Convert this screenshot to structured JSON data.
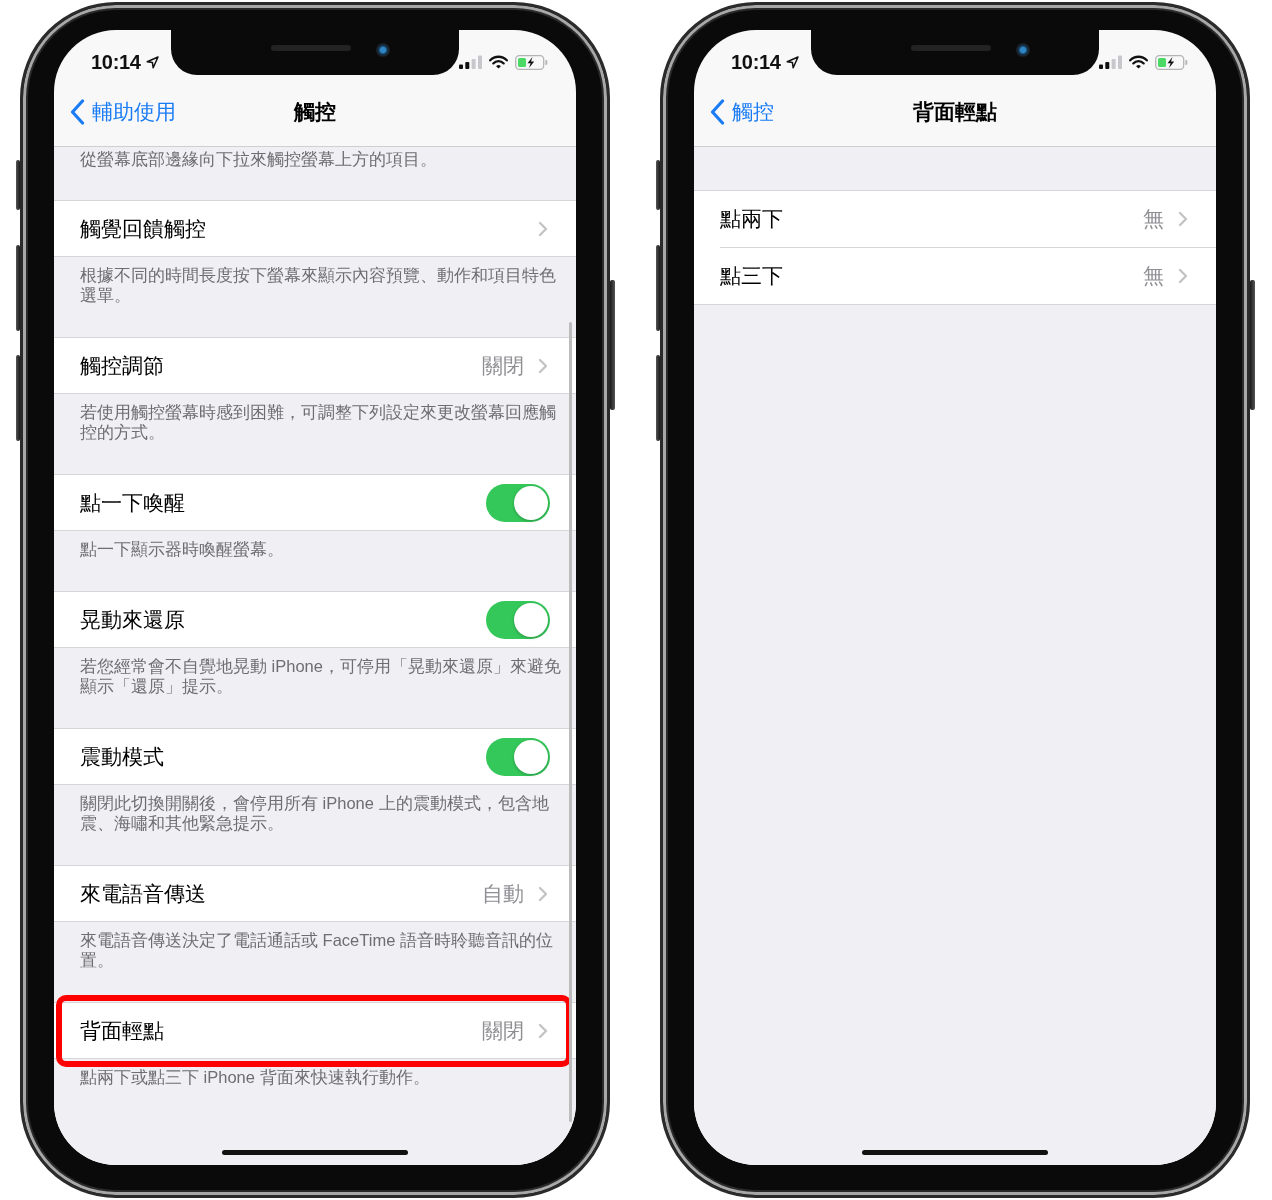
{
  "screens": [
    {
      "time": "10:14",
      "back": "輔助使用",
      "title": "觸控",
      "scroll_bar": true,
      "items": [
        {
          "kind": "footer",
          "text": "從螢幕底部邊緣向下拉來觸控螢幕上方的項目。"
        },
        {
          "kind": "disclosure",
          "label": "觸覺回饋觸控",
          "highlighted": false
        },
        {
          "kind": "footer",
          "text": "根據不同的時間長度按下螢幕來顯示內容預覽、動作和項目特色選單。"
        },
        {
          "kind": "disclosure",
          "label": "觸控調節",
          "value": "關閉",
          "highlighted": false
        },
        {
          "kind": "footer",
          "text": "若使用觸控螢幕時感到困難，可調整下列設定來更改螢幕回應觸控的方式。"
        },
        {
          "kind": "toggle",
          "label": "點一下喚醒",
          "on": true,
          "highlighted": false
        },
        {
          "kind": "footer",
          "text": "點一下顯示器時喚醒螢幕。"
        },
        {
          "kind": "toggle",
          "label": "晃動來還原",
          "on": true,
          "highlighted": false
        },
        {
          "kind": "footer",
          "text": "若您經常會不自覺地晃動 iPhone，可停用「晃動來還原」來避免顯示「還原」提示。"
        },
        {
          "kind": "toggle",
          "label": "震動模式",
          "on": true,
          "highlighted": false
        },
        {
          "kind": "footer",
          "text": "關閉此切換開關後，會停用所有 iPhone 上的震動模式，包含地震、海嘯和其他緊急提示。"
        },
        {
          "kind": "disclosure",
          "label": "來電語音傳送",
          "value": "自動",
          "highlighted": false
        },
        {
          "kind": "footer",
          "text": "來電語音傳送決定了電話通話或 FaceTime 語音時聆聽音訊的位置。"
        },
        {
          "kind": "disclosure",
          "label": "背面輕點",
          "value": "關閉",
          "highlighted": true
        },
        {
          "kind": "footer",
          "text": "點兩下或點三下 iPhone 背面來快速執行動作。"
        }
      ]
    },
    {
      "time": "10:14",
      "back": "觸控",
      "title": "背面輕點",
      "scroll_bar": false,
      "items": [
        {
          "kind": "disclosure",
          "label": "點兩下",
          "value": "無",
          "highlighted": false
        },
        {
          "kind": "disclosure",
          "label": "點三下",
          "value": "無",
          "highlighted": false
        }
      ]
    }
  ]
}
